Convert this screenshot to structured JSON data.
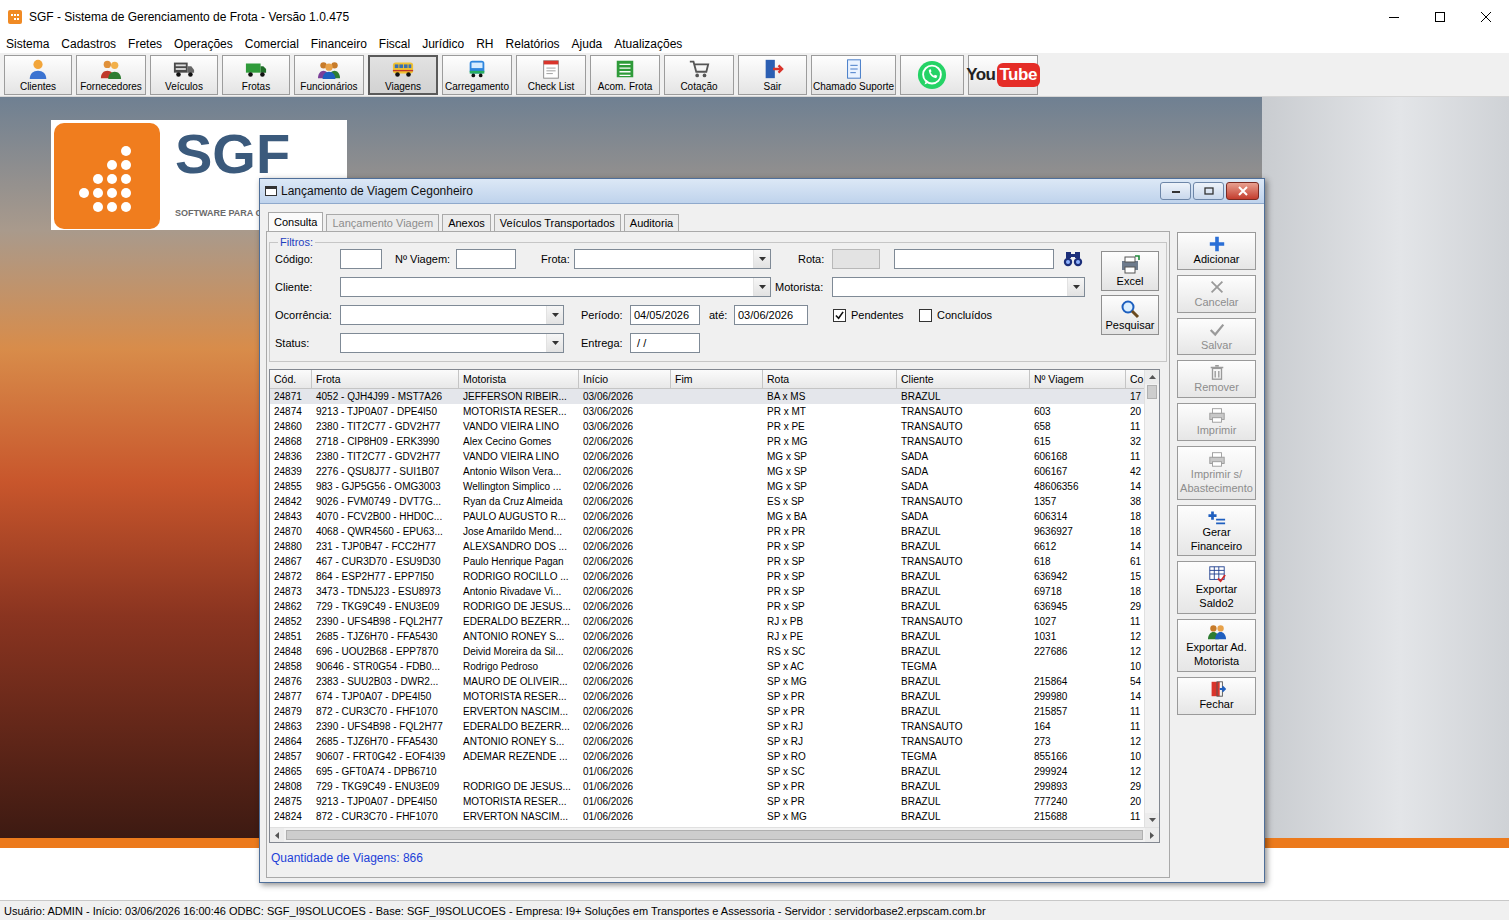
{
  "window": {
    "title": "SGF - Sistema de Gerenciamento de Frota - Versão 1.0.475"
  },
  "menu": [
    "Sistema",
    "Cadastros",
    "Fretes",
    "Operações",
    "Comercial",
    "Financeiro",
    "Fiscal",
    "Jurídico",
    "RH",
    "Relatórios",
    "Ajuda",
    "Atualizações"
  ],
  "toolbar": [
    {
      "label": "Clientes",
      "pressed": false
    },
    {
      "label": "Fornecedores",
      "pressed": false
    },
    {
      "label": "Veículos",
      "pressed": false
    },
    {
      "label": "Frotas",
      "pressed": false
    },
    {
      "label": "Funcionários",
      "pressed": false
    },
    {
      "label": "Viagens",
      "pressed": true
    },
    {
      "label": "Carregamento",
      "pressed": false
    },
    {
      "label": "Check List",
      "pressed": false
    },
    {
      "label": "Acom. Frota",
      "pressed": false
    },
    {
      "label": "Cotação",
      "pressed": false
    },
    {
      "label": "Sair",
      "pressed": false
    },
    {
      "label": "Chamado Suporte",
      "pressed": false
    }
  ],
  "toolbar_links": [
    {
      "kind": "whatsapp",
      "parts": []
    },
    {
      "kind": "youtube",
      "parts": [
        "You",
        "Tube"
      ]
    }
  ],
  "logo": {
    "mark": "SGF",
    "tagline": "SOFTWARE PARA G"
  },
  "dialog": {
    "title": "Lançamento de Viagem Cegonheiro",
    "tabs": [
      {
        "label": "Consulta",
        "selected": true,
        "disabled": false
      },
      {
        "label": "Lançamento Viagem",
        "selected": false,
        "disabled": true
      },
      {
        "label": "Anexos",
        "selected": false,
        "disabled": false
      },
      {
        "label": "Veículos Transportados",
        "selected": false,
        "disabled": false
      },
      {
        "label": "Auditoria",
        "selected": false,
        "disabled": false
      }
    ],
    "filters": {
      "legend": "Filtros:",
      "rows": [
        [
          {
            "kind": "label",
            "text": "Código:"
          },
          {
            "kind": "input",
            "value": "",
            "disabled": false
          },
          {
            "kind": "label",
            "text": "Nº Viagem:"
          },
          {
            "kind": "input",
            "value": "",
            "disabled": false
          },
          {
            "kind": "label",
            "text": "Frota:"
          },
          {
            "kind": "combo",
            "value": ""
          },
          {
            "kind": "label",
            "text": "Rota:"
          },
          {
            "kind": "input",
            "value": "",
            "disabled": true
          },
          {
            "kind": "input",
            "value": "",
            "disabled": false
          },
          {
            "kind": "search"
          }
        ],
        [
          {
            "kind": "label",
            "text": "Cliente:"
          },
          {
            "kind": "combo",
            "value": ""
          },
          {
            "kind": "label",
            "text": "Motorista:"
          },
          {
            "kind": "combo",
            "value": ""
          }
        ],
        [
          {
            "kind": "label",
            "text": "Ocorrência:"
          },
          {
            "kind": "combo",
            "value": ""
          },
          {
            "kind": "label",
            "text": "Período:"
          },
          {
            "kind": "input",
            "value": "04/05/2026",
            "disabled": false
          },
          {
            "kind": "label",
            "text": "até:"
          },
          {
            "kind": "input",
            "value": "03/06/2026",
            "disabled": false
          },
          {
            "kind": "checkbox",
            "text": "Pendentes",
            "checked": true
          },
          {
            "kind": "checkbox",
            "text": "Concluídos",
            "checked": false
          }
        ],
        [
          {
            "kind": "label",
            "text": "Status:"
          },
          {
            "kind": "combo",
            "value": ""
          },
          {
            "kind": "label",
            "text": "Entrega:"
          },
          {
            "kind": "input",
            "value": " / /",
            "disabled": false
          }
        ]
      ]
    },
    "filter_buttons": [
      {
        "label": "Excel"
      },
      {
        "label": "Pesquisar"
      }
    ],
    "table": {
      "columns": [
        "Cód.",
        "Frota",
        "Motorista",
        "Início",
        "Fim",
        "Rota",
        "Cliente",
        "Nº Viagem",
        "Co"
      ],
      "rows": [
        {
          "cells": [
            "24871",
            "4052 - QJH4J99 - MST7A26",
            "JEFFERSON RIBEIR...",
            "03/06/2026",
            "",
            "BA x MS",
            "BRAZUL",
            "",
            "17"
          ],
          "selected": true
        },
        {
          "cells": [
            "24874",
            "9213 - TJP0A07 - DPE4I50",
            "MOTORISTA RESER...",
            "03/06/2026",
            "",
            "PR x MT",
            "TRANSAUTO",
            "603",
            "20"
          ],
          "selected": false
        },
        {
          "cells": [
            "24860",
            "2380 - TIT2C77 - GDV2H77",
            "VANDO VIEIRA LINO",
            "03/06/2026",
            "",
            "PR x PE",
            "TRANSAUTO",
            "658",
            "11"
          ],
          "selected": false
        },
        {
          "cells": [
            "24868",
            "2718 - CIP8H09 - ERK3990",
            "Alex Cecino Gomes",
            "02/06/2026",
            "",
            "PR x MG",
            "TRANSAUTO",
            "615",
            "32"
          ],
          "selected": false
        },
        {
          "cells": [
            "24836",
            "2380 - TIT2C77 - GDV2H77",
            "VANDO VIEIRA LINO",
            "02/06/2026",
            "",
            "MG x SP",
            "SADA",
            "606168",
            "11"
          ],
          "selected": false
        },
        {
          "cells": [
            "24839",
            "2276 - QSU8J77 - SUI1B07",
            "Antonio Wilson Vera...",
            "02/06/2026",
            "",
            "MG x SP",
            "SADA",
            "606167",
            "42"
          ],
          "selected": false
        },
        {
          "cells": [
            "24855",
            "983 - GJP5G56 - OMG3003",
            "Wellington Simplico ...",
            "02/06/2026",
            "",
            "MG x SP",
            "SADA",
            "48606356",
            "14"
          ],
          "selected": false
        },
        {
          "cells": [
            "24842",
            "9026 - FVM0749 - DVT7G...",
            "Ryan da Cruz Almeida",
            "02/06/2026",
            "",
            "ES x SP",
            "TRANSAUTO",
            "1357",
            "38"
          ],
          "selected": false
        },
        {
          "cells": [
            "24843",
            "4070 - FCV2B00 - HHD0C...",
            "PAULO AUGUSTO R...",
            "02/06/2026",
            "",
            "MG x BA",
            "SADA",
            "606314",
            "18"
          ],
          "selected": false
        },
        {
          "cells": [
            "24870",
            "4068 - QWR4560 - EPU63...",
            "Jose Amarildo Mend...",
            "02/06/2026",
            "",
            "PR x PR",
            "BRAZUL",
            "9636927",
            "18"
          ],
          "selected": false
        },
        {
          "cells": [
            "24880",
            "231 - TJP0B47 - FCC2H77",
            "ALEXSANDRO DOS ...",
            "02/06/2026",
            "",
            "PR x SP",
            "BRAZUL",
            "6612",
            "14"
          ],
          "selected": false
        },
        {
          "cells": [
            "24867",
            "467 - CUR3D70 - ESU9D30",
            "Paulo Henrique Pagan",
            "02/06/2026",
            "",
            "PR x SP",
            "TRANSAUTO",
            "618",
            "61"
          ],
          "selected": false
        },
        {
          "cells": [
            "24872",
            "864 - ESP2H77 - EPP7I50",
            "RODRIGO ROCILLO ...",
            "02/06/2026",
            "",
            "PR x SP",
            "BRAZUL",
            "636942",
            "15"
          ],
          "selected": false
        },
        {
          "cells": [
            "24873",
            "3473 - TDN5J23 - ESU8973",
            "Antonio Rivadave Vi...",
            "02/06/2026",
            "",
            "PR x SP",
            "BRAZUL",
            "69718",
            "18"
          ],
          "selected": false
        },
        {
          "cells": [
            "24862",
            "729 - TKG9C49 - ENU3E09",
            "RODRIGO DE JESUS...",
            "02/06/2026",
            "",
            "PR x SP",
            "BRAZUL",
            "636945",
            "29"
          ],
          "selected": false
        },
        {
          "cells": [
            "24852",
            "2390 - UFS4B98 - FQL2H77",
            "EDERALDO BEZERR...",
            "02/06/2026",
            "",
            "RJ x PB",
            "TRANSAUTO",
            "1027",
            "11"
          ],
          "selected": false
        },
        {
          "cells": [
            "24851",
            "2685 - TJZ6H70 - FFA5430",
            "ANTONIO RONEY S...",
            "02/06/2026",
            "",
            "RJ x PE",
            "BRAZUL",
            "1031",
            "12"
          ],
          "selected": false
        },
        {
          "cells": [
            "24848",
            "696 - UOU2B68 - EPP7870",
            "Deivid Moreira da Sil...",
            "02/06/2026",
            "",
            "RS x SC",
            "BRAZUL",
            "227686",
            "12"
          ],
          "selected": false
        },
        {
          "cells": [
            "24858",
            "90646 - STR0G54 - FDB0...",
            "Rodrigo Pedroso",
            "02/06/2026",
            "",
            "SP x AC",
            "TEGMA",
            "",
            "10"
          ],
          "selected": false
        },
        {
          "cells": [
            "24876",
            "2383 - SUU2B03 - DWR2...",
            "MAURO DE OLIVEIR...",
            "02/06/2026",
            "",
            "SP x MG",
            "BRAZUL",
            "215864",
            "54"
          ],
          "selected": false
        },
        {
          "cells": [
            "24877",
            "674 - TJP0A07 - DPE4I50",
            "MOTORISTA RESER...",
            "02/06/2026",
            "",
            "SP x PR",
            "BRAZUL",
            "299980",
            "14"
          ],
          "selected": false
        },
        {
          "cells": [
            "24879",
            "872 - CUR3C70 - FHF1070",
            "ERVERTON NASCIM...",
            "02/06/2026",
            "",
            "SP x PR",
            "BRAZUL",
            "215857",
            "11"
          ],
          "selected": false
        },
        {
          "cells": [
            "24863",
            "2390 - UFS4B98 - FQL2H77",
            "EDERALDO BEZERR...",
            "02/06/2026",
            "",
            "SP x RJ",
            "TRANSAUTO",
            "164",
            "11"
          ],
          "selected": false
        },
        {
          "cells": [
            "24864",
            "2685 - TJZ6H70 - FFA5430",
            "ANTONIO RONEY S...",
            "02/06/2026",
            "",
            "SP x RJ",
            "TRANSAUTO",
            "273",
            "12"
          ],
          "selected": false
        },
        {
          "cells": [
            "24857",
            "90607 - FRT0G42 - EOF4I39",
            "ADEMAR REZENDE ...",
            "02/06/2026",
            "",
            "SP x RO",
            "TEGMA",
            "855166",
            "10"
          ],
          "selected": false
        },
        {
          "cells": [
            "24865",
            "695 - GFT0A74 - DPB6710",
            "",
            "01/06/2026",
            "",
            "SP x SC",
            "BRAZUL",
            "299924",
            "12"
          ],
          "selected": false
        },
        {
          "cells": [
            "24808",
            "729 - TKG9C49 - ENU3E09",
            "RODRIGO DE JESUS...",
            "01/06/2026",
            "",
            "SP x PR",
            "BRAZUL",
            "299893",
            "29"
          ],
          "selected": false
        },
        {
          "cells": [
            "24875",
            "9213 - TJP0A07 - DPE4I50",
            "MOTORISTA RESER...",
            "01/06/2026",
            "",
            "SP x PR",
            "BRAZUL",
            "777240",
            "20"
          ],
          "selected": false
        },
        {
          "cells": [
            "24824",
            "872 - CUR3C70 - FHF1070",
            "ERVERTON NASCIM...",
            "01/06/2026",
            "",
            "SP x MG",
            "BRAZUL",
            "215688",
            "11"
          ],
          "selected": false
        }
      ]
    },
    "count": "Quantidade de Viagens: 866",
    "buttons": [
      {
        "label": "Adicionar",
        "disabled": false
      },
      {
        "label": "Cancelar",
        "disabled": true
      },
      {
        "label": "Salvar",
        "disabled": true
      },
      {
        "label": "Remover",
        "disabled": true
      },
      {
        "label": "Imprimir",
        "disabled": true
      },
      {
        "label": "Imprimir s/ Abastecimento",
        "disabled": true
      },
      {
        "label": "Gerar Financeiro",
        "disabled": false
      },
      {
        "label": "Exportar Saldo2",
        "disabled": false
      },
      {
        "label": "Exportar Ad. Motorista",
        "disabled": false
      },
      {
        "label": "Fechar",
        "disabled": false
      }
    ]
  },
  "status_bar": "Usuário: ADMIN - Início: 03/06/2026 16:00:46 ODBC: SGF_I9SOLUCOES - Base: SGF_I9SOLUCOES - Empresa: I9+ Soluções em Transportes e Assessoria - Servidor : servidorbase2.erpscam.com.br"
}
